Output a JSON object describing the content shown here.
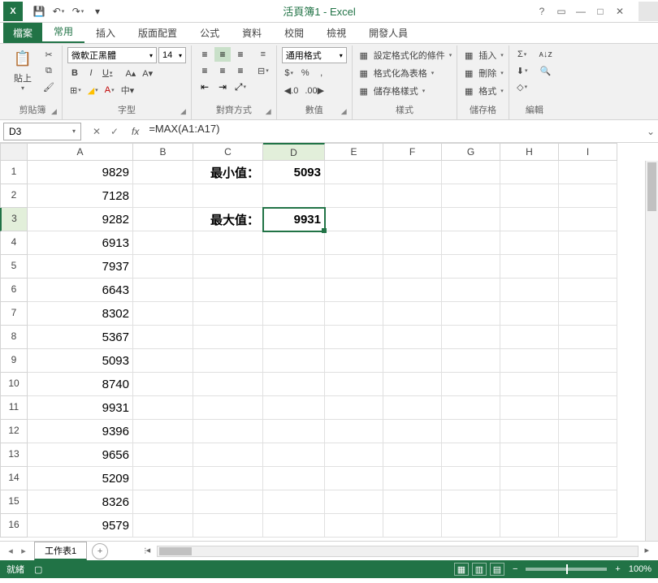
{
  "title": "活頁簿1 - Excel",
  "qat": {
    "save": "💾",
    "undo": "↶",
    "redo": "↷"
  },
  "win": {
    "help": "?",
    "ribbon": "▭",
    "min": "—",
    "max": "□",
    "close": "✕"
  },
  "tabs": {
    "file": "檔案",
    "items": [
      "常用",
      "插入",
      "版面配置",
      "公式",
      "資料",
      "校閱",
      "檢視",
      "開發人員"
    ],
    "active": 0
  },
  "ribbon": {
    "clipboard": {
      "label": "剪貼簿",
      "paste": "貼上"
    },
    "font": {
      "label": "字型",
      "name": "微軟正黑體",
      "size": "14",
      "bold": "B",
      "italic": "I",
      "underline": "U",
      "border": "⊞",
      "fill": "◢",
      "color": "A",
      "phonetic": "中▾"
    },
    "align": {
      "label": "對齊方式",
      "wrap": "≡",
      "merge": "⊟"
    },
    "number": {
      "label": "數值",
      "format": "通用格式",
      "currency": "$",
      "percent": "%",
      "comma": ",",
      "inc": "◀.0",
      "dec": ".00▶"
    },
    "styles": {
      "label": "樣式",
      "cond": "設定格式化的條件",
      "table": "格式化為表格",
      "cell": "儲存格樣式"
    },
    "cells": {
      "label": "儲存格",
      "insert": "插入",
      "delete": "刪除",
      "format": "格式"
    },
    "editing": {
      "label": "編輯",
      "sum": "Σ",
      "sort": "ᴀ↓ᴢ",
      "find": "🔍",
      "fill": "⬇",
      "clear": "◇"
    }
  },
  "nameBox": "D3",
  "formula": "=MAX(A1:A17)",
  "columns": [
    "A",
    "B",
    "C",
    "D",
    "E",
    "F",
    "G",
    "H",
    "I"
  ],
  "activeCol": 3,
  "activeRow": 3,
  "rows": [
    {
      "n": 1,
      "A": "9829",
      "C": "最小值：",
      "D": "5093"
    },
    {
      "n": 2,
      "A": "7128"
    },
    {
      "n": 3,
      "A": "9282",
      "C": "最大值：",
      "D": "9931"
    },
    {
      "n": 4,
      "A": "6913"
    },
    {
      "n": 5,
      "A": "7937"
    },
    {
      "n": 6,
      "A": "6643"
    },
    {
      "n": 7,
      "A": "8302"
    },
    {
      "n": 8,
      "A": "5367"
    },
    {
      "n": 9,
      "A": "5093"
    },
    {
      "n": 10,
      "A": "8740"
    },
    {
      "n": 11,
      "A": "9931"
    },
    {
      "n": 12,
      "A": "9396"
    },
    {
      "n": 13,
      "A": "9656"
    },
    {
      "n": 14,
      "A": "5209"
    },
    {
      "n": 15,
      "A": "8326"
    },
    {
      "n": 16,
      "A": "9579"
    }
  ],
  "sheet": {
    "name": "工作表1"
  },
  "status": {
    "ready": "就緒",
    "zoom": "100%"
  }
}
